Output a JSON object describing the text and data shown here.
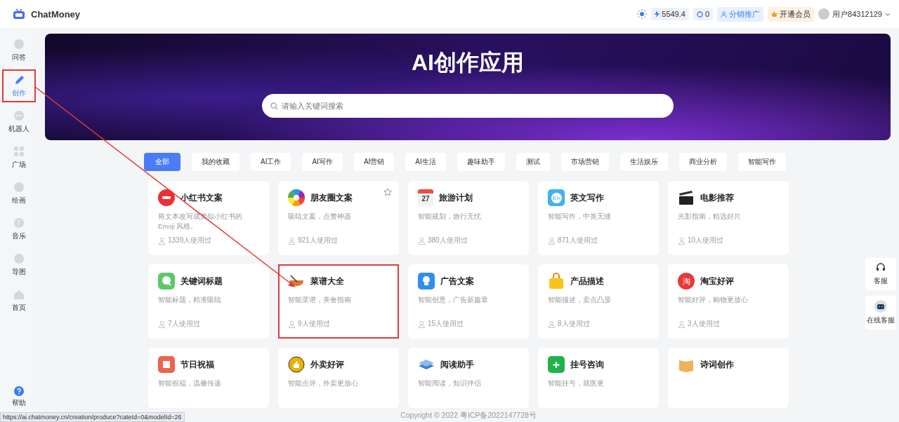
{
  "header": {
    "logo_text": "ChatMoney",
    "balance": "5549.4",
    "count": "0",
    "promo_label": "分销推广",
    "vip_label": "开通会员",
    "user_name": "用户84312129"
  },
  "sidebar": {
    "items": [
      {
        "label": "问答",
        "selected": false,
        "highlighted": false
      },
      {
        "label": "创作",
        "selected": true,
        "highlighted": true
      },
      {
        "label": "机器人",
        "selected": false,
        "highlighted": false
      },
      {
        "label": "广场",
        "selected": false,
        "highlighted": false
      },
      {
        "label": "绘画",
        "selected": false,
        "highlighted": false
      },
      {
        "label": "音乐",
        "selected": false,
        "highlighted": false
      },
      {
        "label": "导图",
        "selected": false,
        "highlighted": false
      },
      {
        "label": "首页",
        "selected": false,
        "highlighted": false
      }
    ],
    "help_label": "帮助"
  },
  "banner": {
    "title": "AI创作应用",
    "search": {
      "placeholder": "请输入关键词搜索"
    }
  },
  "tabs": [
    {
      "label": "全部",
      "selected": true
    },
    {
      "label": "我的收藏",
      "selected": false
    },
    {
      "label": "AI工作",
      "selected": false
    },
    {
      "label": "AI写作",
      "selected": false
    },
    {
      "label": "AI营销",
      "selected": false
    },
    {
      "label": "AI生活",
      "selected": false
    },
    {
      "label": "趣味助手",
      "selected": false
    },
    {
      "label": "测试",
      "selected": false
    },
    {
      "label": "市场营销",
      "selected": false
    },
    {
      "label": "生活娱乐",
      "selected": false
    },
    {
      "label": "商业分析",
      "selected": false
    },
    {
      "label": "智能写作",
      "selected": false
    }
  ],
  "cards": [
    {
      "title": "小红书文案",
      "description": "将文本改写成类似小红书的 Emoji 风格。",
      "usage": "1339人使用过",
      "starred": false,
      "highlighted": false
    },
    {
      "title": "朋友圈文案",
      "description": "吸睛文案，点赞神器",
      "usage": "921人使用过",
      "starred": true,
      "highlighted": false
    },
    {
      "title": "旅游计划",
      "description": "智能规划，旅行无忧",
      "usage": "380人使用过",
      "starred": false,
      "highlighted": false,
      "icon_text": "27"
    },
    {
      "title": "英文写作",
      "description": "智能写作，中英无缝",
      "usage": "871人使用过",
      "starred": false,
      "highlighted": false,
      "icon_text": "En"
    },
    {
      "title": "电影推荐",
      "description": "光影指南，精选好片",
      "usage": "10人使用过",
      "starred": false,
      "highlighted": false
    },
    {
      "title": "关键词标题",
      "description": "智能标题，精准吸睛",
      "usage": "7人使用过",
      "starred": false,
      "highlighted": false
    },
    {
      "title": "菜谱大全",
      "description": "智能菜谱，美食指南",
      "usage": "9人使用过",
      "starred": false,
      "highlighted": true
    },
    {
      "title": "广告文案",
      "description": "智能创意，广告新篇章",
      "usage": "15人使用过",
      "starred": false,
      "highlighted": false
    },
    {
      "title": "产品描述",
      "description": "智能描述，卖点凸显",
      "usage": "8人使用过",
      "starred": false,
      "highlighted": false
    },
    {
      "title": "淘宝好评",
      "description": "智能好评，购物更放心",
      "usage": "3人使用过",
      "starred": false,
      "highlighted": false,
      "icon_text": "淘"
    },
    {
      "title": "节日祝福",
      "description": "智能祝福，温馨传递",
      "starred": false,
      "highlighted": false
    },
    {
      "title": "外卖好评",
      "description": "智能点评，外卖更放心",
      "starred": false,
      "highlighted": false
    },
    {
      "title": "阅读助手",
      "description": "智能阅读，知识伴侣",
      "starred": false,
      "highlighted": false
    },
    {
      "title": "挂号咨询",
      "description": "智能挂号，就医更",
      "starred": false,
      "highlighted": false
    },
    {
      "title": "诗词创作",
      "starred": false,
      "highlighted": false
    }
  ],
  "float_buttons": [
    {
      "label": "客服"
    },
    {
      "label": "在线客服"
    }
  ],
  "footer": "Copyright © 2022 粤ICP备2022147728号",
  "status_url": "https://ai.chatmoney.cn/creation/produce?cateId=0&modelId=26"
}
